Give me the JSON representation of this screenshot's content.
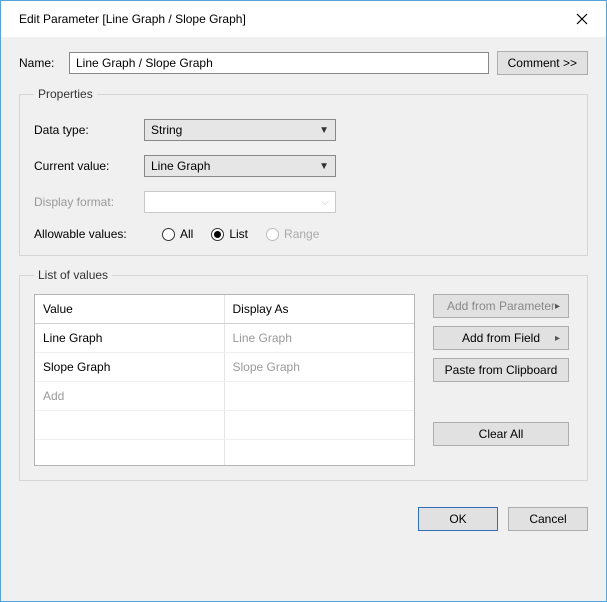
{
  "titlebar": {
    "title": "Edit Parameter [Line Graph / Slope Graph]"
  },
  "name_row": {
    "label": "Name:",
    "value": "Line Graph / Slope Graph",
    "comment_btn": "Comment >>"
  },
  "properties": {
    "legend": "Properties",
    "data_type_label": "Data type:",
    "data_type_value": "String",
    "current_value_label": "Current value:",
    "current_value_value": "Line Graph",
    "display_format_label": "Display format:",
    "display_format_value": "",
    "allowable_label": "Allowable values:",
    "radio_all": "All",
    "radio_list": "List",
    "radio_range": "Range"
  },
  "list_of_values": {
    "legend": "List of values",
    "col_value": "Value",
    "col_display": "Display As",
    "rows": {
      "r0": {
        "value": "Line Graph",
        "display": "Line Graph"
      },
      "r1": {
        "value": "Slope Graph",
        "display": "Slope Graph"
      },
      "add": "Add"
    },
    "buttons": {
      "add_param": "Add from Parameter",
      "add_field": "Add from Field",
      "paste": "Paste from Clipboard",
      "clear": "Clear All"
    }
  },
  "footer": {
    "ok": "OK",
    "cancel": "Cancel"
  }
}
